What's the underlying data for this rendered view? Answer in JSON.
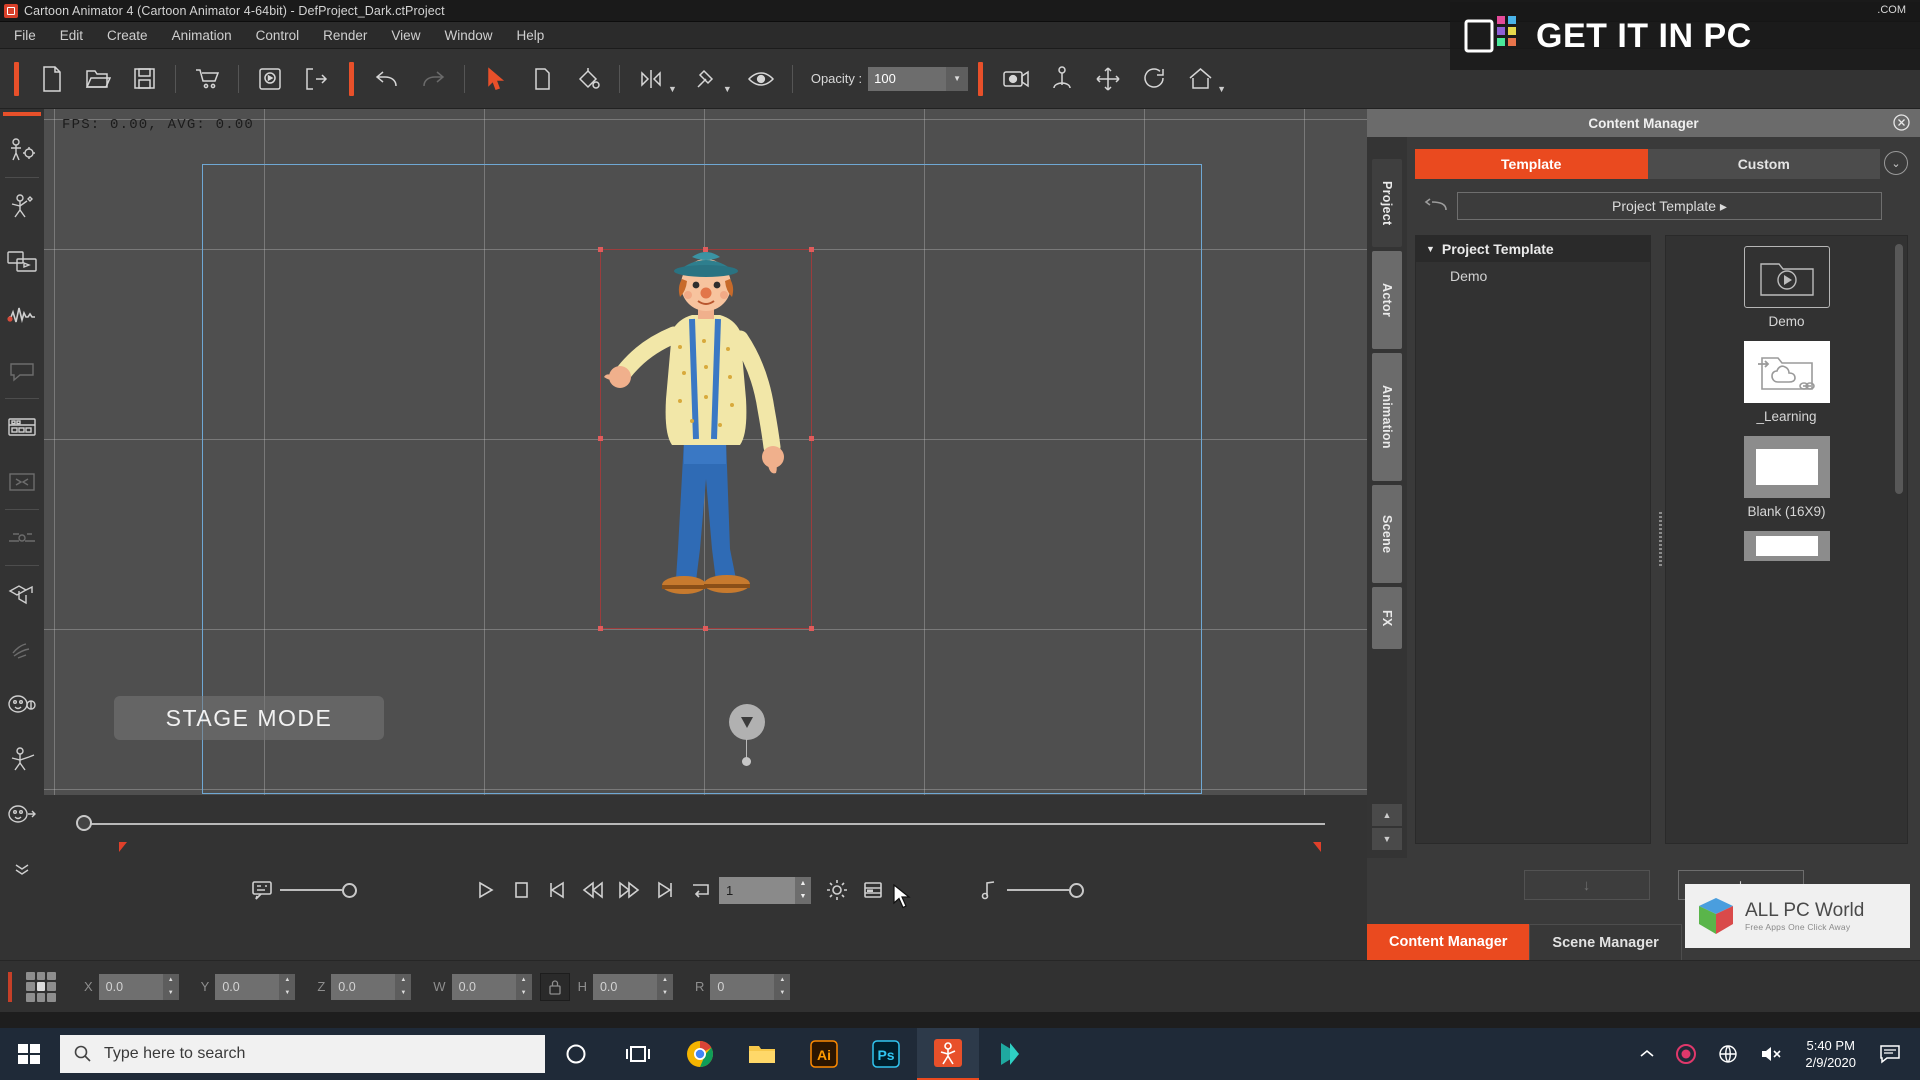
{
  "window": {
    "title": "Cartoon Animator 4  (Cartoon Animator 4-64bit) - DefProject_Dark.ctProject"
  },
  "menubar": {
    "items": [
      {
        "label": "File"
      },
      {
        "label": "Edit"
      },
      {
        "label": "Create"
      },
      {
        "label": "Animation"
      },
      {
        "label": "Control"
      },
      {
        "label": "Render"
      },
      {
        "label": "View"
      },
      {
        "label": "Window"
      },
      {
        "label": "Help"
      }
    ]
  },
  "toolbar": {
    "opacity_label": "Opacity :",
    "opacity_value": "100",
    "icons": [
      "new-project-icon",
      "open-project-icon",
      "save-project-icon",
      "marketplace-cart-icon",
      "preview-render-icon",
      "export-icon",
      "undo-icon",
      "redo-icon",
      "select-tool-icon",
      "transform-tool-icon",
      "fill-color-icon",
      "flip-icon",
      "link-icon",
      "visibility-eye-icon",
      "camera-preview-icon",
      "bone-icon",
      "move-icon",
      "rotate-icon",
      "home-icon"
    ]
  },
  "leftbar": {
    "items": [
      {
        "name": "character-setup-icon"
      },
      {
        "name": "motion-puppet-icon"
      },
      {
        "name": "media-clip-icon"
      },
      {
        "name": "audio-waveform-icon"
      },
      {
        "name": "speech-bubble-icon"
      },
      {
        "name": "sprite-editor-icon"
      },
      {
        "name": "face-puppet-icon"
      },
      {
        "name": "motion-path-icon"
      },
      {
        "name": "camera-tool-icon"
      },
      {
        "name": "hand-gesture-icon"
      },
      {
        "name": "face-key-icon"
      },
      {
        "name": "body-puppet-icon"
      },
      {
        "name": "head-turn-icon"
      },
      {
        "name": "expand-more-icon"
      }
    ]
  },
  "stage": {
    "fps_text": "FPS: 0.00, AVG: 0.00",
    "mode_label": "STAGE MODE"
  },
  "transport": {
    "frame_value": "1",
    "buttons": [
      {
        "name": "play-button"
      },
      {
        "name": "stop-button"
      },
      {
        "name": "first-frame-button"
      },
      {
        "name": "previous-frame-button"
      },
      {
        "name": "next-frame-button"
      },
      {
        "name": "last-frame-button"
      },
      {
        "name": "loop-button"
      },
      {
        "name": "render-settings-button"
      },
      {
        "name": "timeline-button"
      }
    ]
  },
  "transform": {
    "fields": [
      {
        "label": "X",
        "value": "0.0"
      },
      {
        "label": "Y",
        "value": "0.0"
      },
      {
        "label": "Z",
        "value": "0.0"
      },
      {
        "label": "W",
        "value": "0.0"
      },
      {
        "label": "H",
        "value": "0.0"
      },
      {
        "label": "R",
        "value": "0"
      }
    ]
  },
  "content_manager": {
    "header_title": "Content Manager",
    "tabs": {
      "template": "Template",
      "custom": "Custom"
    },
    "breadcrumb": "Project Template ▸",
    "vertical_tabs": [
      {
        "label": "Project",
        "active": true
      },
      {
        "label": "Actor",
        "active": false
      },
      {
        "label": "Animation",
        "active": false
      },
      {
        "label": "Scene",
        "active": false
      },
      {
        "label": "FX",
        "active": false
      }
    ],
    "tree": {
      "root": "Project Template",
      "children": [
        "Demo"
      ]
    },
    "thumbnails": [
      {
        "label": "Demo",
        "kind": "folder-play"
      },
      {
        "label": "_Learning",
        "kind": "cloud-link"
      },
      {
        "label": "Blank (16X9)",
        "kind": "blank"
      },
      {
        "label": "",
        "kind": "blank"
      }
    ],
    "footer_buttons": [
      {
        "name": "download-button",
        "label": "↓"
      },
      {
        "name": "add-button",
        "label": "+"
      }
    ]
  },
  "bottom_tabs": [
    {
      "label": "Content Manager",
      "active": true
    },
    {
      "label": "Scene Manager",
      "active": false
    }
  ],
  "watermarks": {
    "getitinpc": "GET IT IN PC",
    "getitinpc_domain": ".COM",
    "allpcworld_title": "ALL PC World",
    "allpcworld_tagline": "Free Apps One Click Away"
  },
  "taskbar": {
    "search_placeholder": "Type here to search",
    "apps": [
      {
        "name": "cortana-icon"
      },
      {
        "name": "task-view-icon"
      },
      {
        "name": "chrome-icon"
      },
      {
        "name": "file-explorer-icon"
      },
      {
        "name": "illustrator-icon",
        "label": "Ai"
      },
      {
        "name": "photoshop-icon",
        "label": "Ps"
      },
      {
        "name": "cartoon-animator-icon"
      },
      {
        "name": "media-player-icon"
      }
    ],
    "time": "5:40 PM",
    "date": "2/9/2020"
  },
  "colors": {
    "accent": "#ea4a1f",
    "toolbar_bg": "#333333",
    "stage_bg": "#4f4f4f",
    "panel_bg": "#3a3a3a",
    "taskbar_bg": "#1f2a38"
  }
}
